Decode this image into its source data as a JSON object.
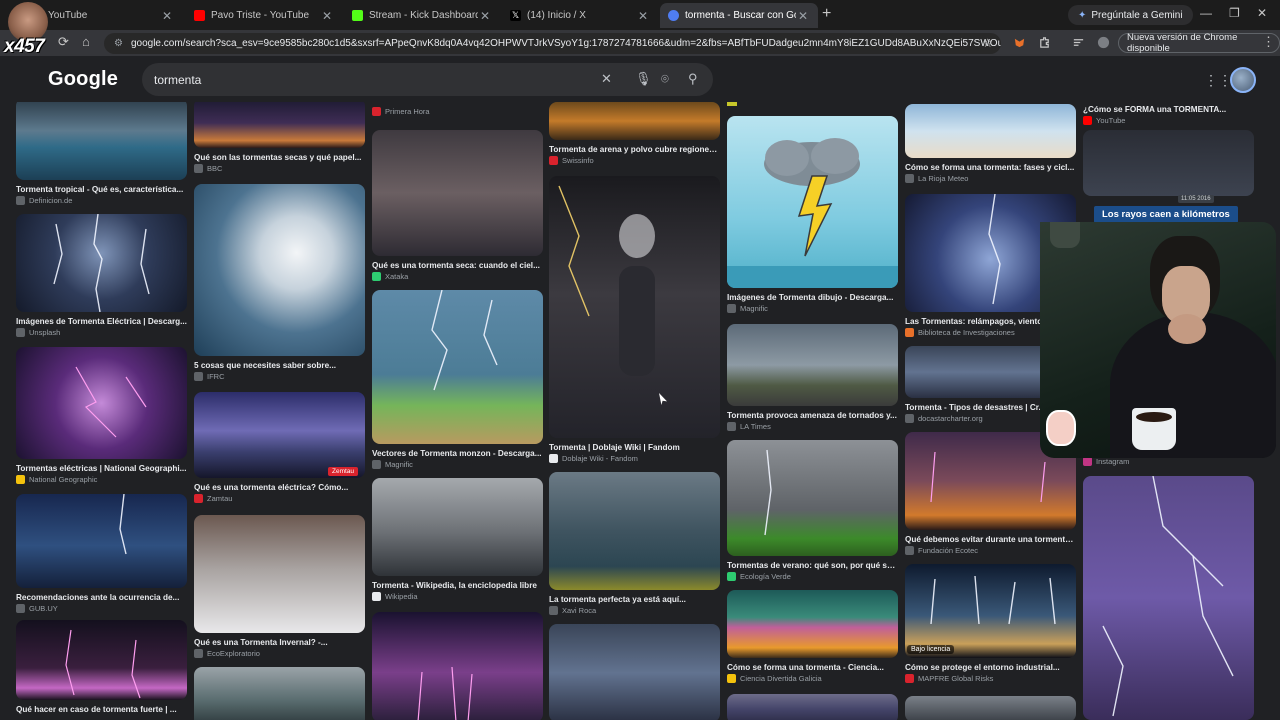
{
  "channel": {
    "tag": "x457"
  },
  "tabs": [
    {
      "title": "YouTube",
      "fav": "yt"
    },
    {
      "title": "Pavo Triste - YouTube",
      "fav": "yt"
    },
    {
      "title": "Stream - Kick Dashboard",
      "fav": "kick"
    },
    {
      "title": "(14) Inicio / X",
      "fav": "xlogo"
    },
    {
      "title": "tormenta - Buscar con Google",
      "fav": "google",
      "active": true
    }
  ],
  "browser": {
    "gemini_label": "Pregúntale a Gemini",
    "url": "google.com/search?sca_esv=9ce9585bc280c1d5&sxsrf=APpeQnvK8dq0A4vq42OHPWVTJrkVSyoY1g:1787274781666&udm=2&fbs=ABfTbFUDadgeu2mn4mY8iEZ1GUDd8ABuXxNzQEi57SWOuuPdWm6...",
    "update_label": "Nueva versión de Chrome disponible"
  },
  "google": {
    "logo": "Google",
    "query": "tormenta"
  },
  "results": [
    {
      "title": "Tormenta tropical - Qué es, característica...",
      "source": "Definicion.de"
    },
    {
      "title": "Imágenes de Tormenta Eléctrica | Descarg...",
      "source": "Unsplash"
    },
    {
      "title": "Tormentas eléctricas | National Geographi...",
      "source": "National Geographic"
    },
    {
      "title": "Recomendaciones ante la ocurrencia de...",
      "source": "GUB.UY"
    },
    {
      "title": "Qué hacer en caso de tormenta fuerte | ...",
      "source": ""
    },
    {
      "title": "Qué son las tormentas secas y qué papel...",
      "source": "BBC"
    },
    {
      "title": "5 cosas que necesites saber sobre...",
      "source": "IFRC"
    },
    {
      "title": "Qué es una tormenta eléctrica? Cómo...",
      "source": "Zamtau"
    },
    {
      "title": "Qué es una Tormenta Invernal? -...",
      "source": "EcoExploratorio"
    },
    {
      "title": "",
      "source": "Primera Hora"
    },
    {
      "title": "Qué es una tormenta seca: cuando el ciel...",
      "source": "Xataka"
    },
    {
      "title": "Vectores de Tormenta monzon - Descarga...",
      "source": "Magnific"
    },
    {
      "title": "Tormenta - Wikipedia, la enciclopedia libre",
      "source": "Wikipedia"
    },
    {
      "title": "Tormenta de arena y polvo cubre regiones...",
      "source": "Swissinfo"
    },
    {
      "title": "Tormenta | Doblaje Wiki | Fandom",
      "source": "Doblaje Wiki - Fandom"
    },
    {
      "title": "La tormenta perfecta ya está aquí...",
      "source": "Xavi Roca"
    },
    {
      "title": "Imágenes de Tormenta dibujo - Descarga...",
      "source": "Magnific"
    },
    {
      "title": "Tormenta provoca amenaza de tornados y...",
      "source": "LA Times"
    },
    {
      "title": "Tormentas de verano: qué son, por qué se...",
      "source": "Ecología Verde"
    },
    {
      "title": "Cómo se forma una tormenta - Ciencia...",
      "source": "Ciencia Divertida Galicia"
    },
    {
      "title": "Cómo se forma una tormenta: fases y cicl...",
      "source": "La Rioja Meteo"
    },
    {
      "title": "Las Tormentas: relámpagos, viento...",
      "source": "Biblioteca de Investigaciones"
    },
    {
      "title": "Tormenta - Tipos de desastres | Cr...",
      "source": "docastarcharter.org"
    },
    {
      "title": "Qué debemos evitar durante una tormenta...",
      "source": "Fundación Ecotec"
    },
    {
      "title": "Cómo se protege el entorno industrial...",
      "source": "MAPFRE Global Risks"
    },
    {
      "title": "¿Cómo se FORMA una TORMENTA...",
      "source": "YouTube"
    },
    {
      "title": "",
      "source": "Instagram"
    }
  ],
  "overlays": {
    "caption": "Los rayos caen a kilómetros",
    "timestamp": "11:05 2016",
    "license": "Bajo licencia",
    "zamtau_tag": "Zemtau"
  }
}
